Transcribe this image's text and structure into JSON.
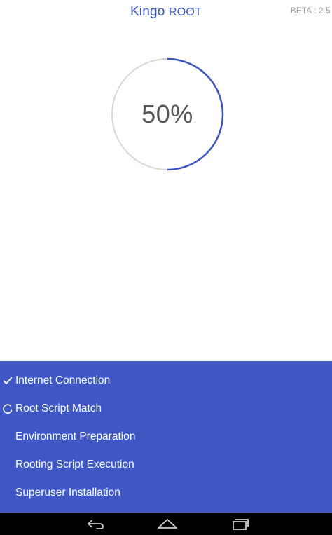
{
  "header": {
    "title_main": "Kingo ",
    "title_accent": "ROOT",
    "version": "BETA : 2.5"
  },
  "progress": {
    "value": 50,
    "label": "50%",
    "accent_color": "#3a55c0",
    "track_color": "#d8d8d8"
  },
  "steps": [
    {
      "label": "Internet Connection",
      "status": "done",
      "icon": "check-icon"
    },
    {
      "label": "Root Script Match",
      "status": "in-progress",
      "icon": "spinner-icon"
    },
    {
      "label": "Environment Preparation",
      "status": "pending",
      "icon": ""
    },
    {
      "label": "Rooting Script Execution",
      "status": "pending",
      "icon": ""
    },
    {
      "label": "Superuser Installation",
      "status": "pending",
      "icon": ""
    }
  ],
  "theme": {
    "panel_color": "#3f56c5",
    "nav_color": "#000000"
  },
  "navigation": {
    "buttons": [
      {
        "name": "back",
        "icon": "back-icon"
      },
      {
        "name": "home",
        "icon": "home-icon"
      },
      {
        "name": "recents",
        "icon": "recents-icon"
      }
    ]
  }
}
